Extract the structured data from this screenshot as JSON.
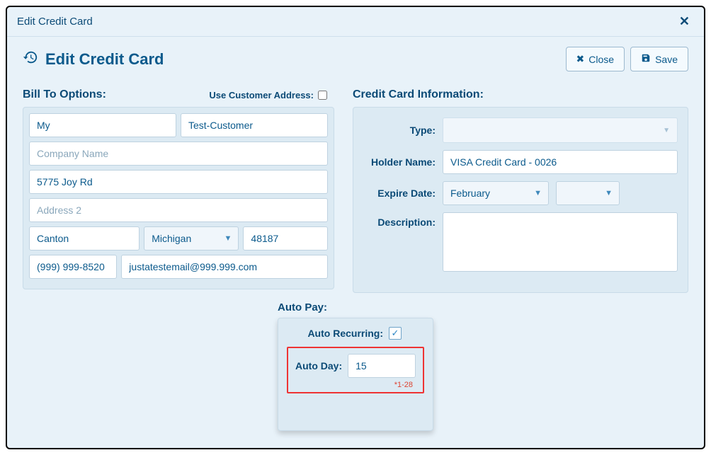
{
  "titlebar": {
    "title": "Edit Credit Card"
  },
  "header": {
    "title": "Edit Credit Card",
    "close_label": "Close",
    "save_label": "Save"
  },
  "billto": {
    "title": "Bill To Options:",
    "use_customer_label": "Use Customer Address:",
    "first_name": "My",
    "last_name": "Test-Customer",
    "company_placeholder": "Company Name",
    "company": "",
    "address1": "5775 Joy Rd",
    "address2_placeholder": "Address 2",
    "address2": "",
    "city": "Canton",
    "state": "Michigan",
    "zip": "48187",
    "phone": "(999) 999-8520",
    "email": "justatestemail@999.999.com"
  },
  "cc": {
    "title": "Credit Card Information:",
    "labels": {
      "type": "Type:",
      "holder": "Holder Name:",
      "expire": "Expire Date:",
      "description": "Description:"
    },
    "holder_name": "VISA Credit Card - 0026",
    "exp_month": "February",
    "exp_year": "",
    "description": ""
  },
  "autopay": {
    "title": "Auto Pay:",
    "recurring_label": "Auto Recurring:",
    "recurring_checked": true,
    "day_label": "Auto Day:",
    "day_value": "15",
    "hint": "*1-28"
  }
}
